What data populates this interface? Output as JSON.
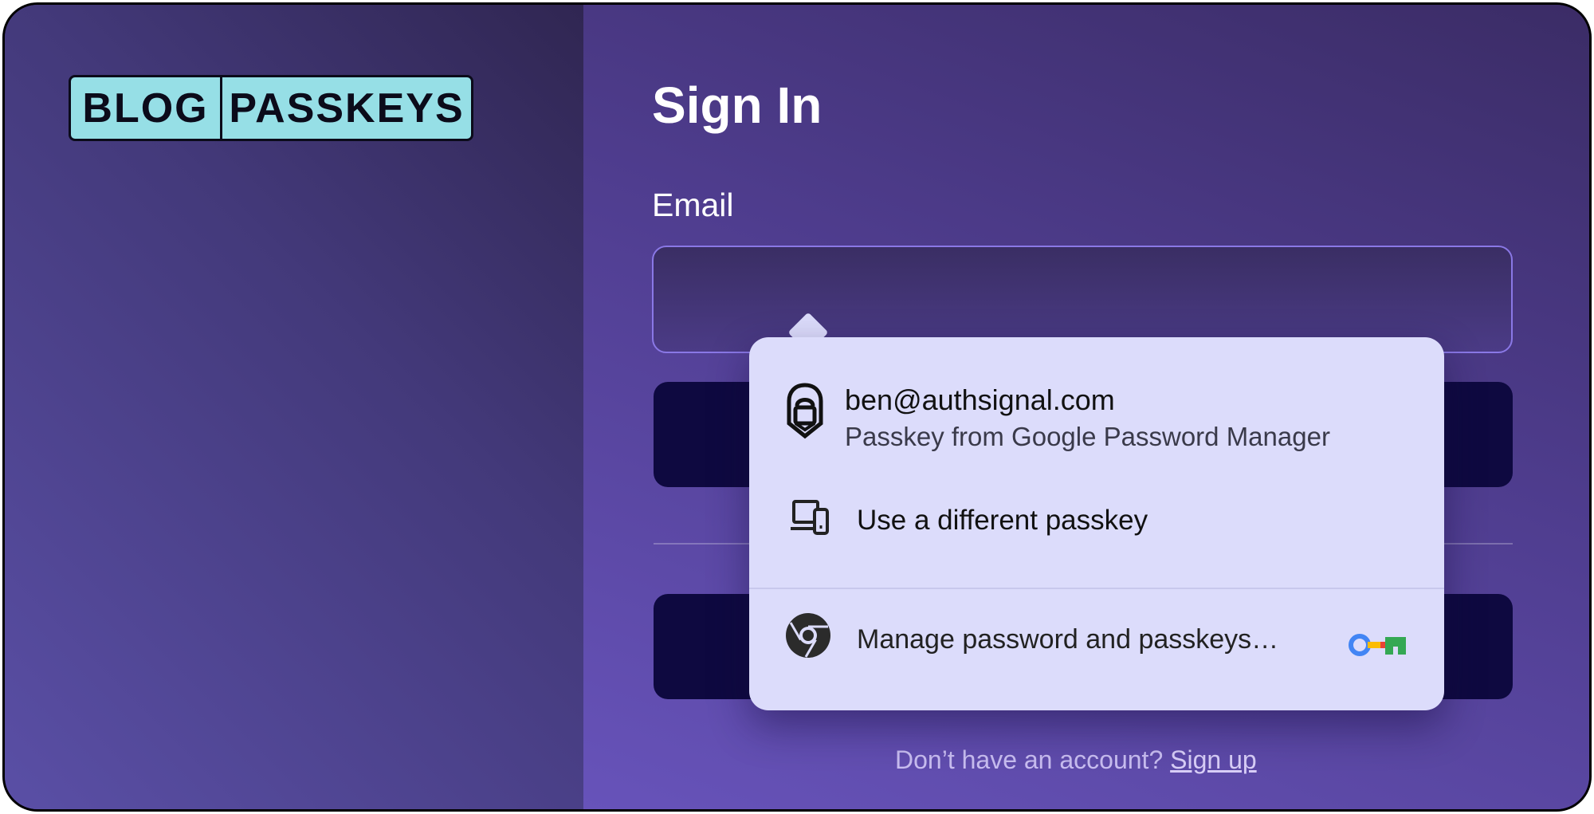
{
  "brand": {
    "logo_left": "BLOG",
    "logo_right": "PASSKEYS"
  },
  "form": {
    "title": "Sign In",
    "email_label": "Email",
    "email_value": "",
    "signup_prompt": "Don’t have an account?",
    "signup_link": "Sign up"
  },
  "passkey_popup": {
    "account_email": "ben@authsignal.com",
    "account_source": "Passkey from Google Password Manager",
    "different_passkey_label": "Use a different passkey",
    "manage_label": "Manage password and passkeys…",
    "icons": {
      "account": "passkey-lock-icon",
      "different": "devices-icon",
      "manage": "chrome-icon",
      "manager": "google-password-manager-key-icon"
    }
  },
  "colors": {
    "accent_cyan": "#96dfe6",
    "button_dark": "#0e0940",
    "popup_bg": "#dcdcfb",
    "input_border": "#8a78e6"
  }
}
